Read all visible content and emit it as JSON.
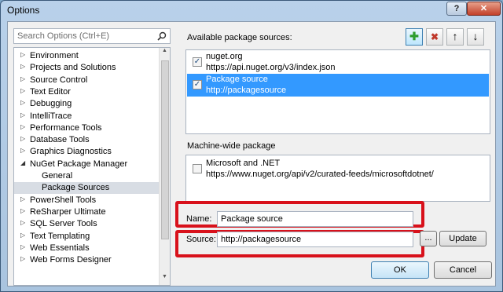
{
  "window": {
    "title": "Options",
    "help_label": "?",
    "close_label": "✕"
  },
  "search": {
    "placeholder": "Search Options (Ctrl+E)"
  },
  "tree": {
    "items": [
      {
        "label": "Environment",
        "expanded": false
      },
      {
        "label": "Projects and Solutions",
        "expanded": false
      },
      {
        "label": "Source Control",
        "expanded": false
      },
      {
        "label": "Text Editor",
        "expanded": false
      },
      {
        "label": "Debugging",
        "expanded": false
      },
      {
        "label": "IntelliTrace",
        "expanded": false
      },
      {
        "label": "Performance Tools",
        "expanded": false
      },
      {
        "label": "Database Tools",
        "expanded": false
      },
      {
        "label": "Graphics Diagnostics",
        "expanded": false
      },
      {
        "label": "NuGet Package Manager",
        "expanded": true
      },
      {
        "label": "General",
        "child": true
      },
      {
        "label": "Package Sources",
        "child": true,
        "selected": true
      },
      {
        "label": "PowerShell Tools",
        "expanded": false
      },
      {
        "label": "ReSharper Ultimate",
        "expanded": false
      },
      {
        "label": "SQL Server Tools",
        "expanded": false
      },
      {
        "label": "Text Templating",
        "expanded": false
      },
      {
        "label": "Web Essentials",
        "expanded": false
      },
      {
        "label": "Web Forms Designer",
        "expanded": false
      }
    ]
  },
  "available": {
    "label": "Available package sources:",
    "sources": [
      {
        "name": "nuget.org",
        "url": "https://api.nuget.org/v3/index.json",
        "checked": true,
        "selected": false
      },
      {
        "name": "Package source",
        "url": "http://packagesource",
        "checked": true,
        "selected": true
      }
    ]
  },
  "toolbar": {
    "add": "✚",
    "remove": "✖",
    "up": "↑",
    "down": "↓"
  },
  "machine_wide": {
    "label": "Machine-wide package",
    "sources": [
      {
        "name": "Microsoft and .NET",
        "url": "https://www.nuget.org/api/v2/curated-feeds/microsoftdotnet/",
        "checked": false
      }
    ]
  },
  "form": {
    "name_label": "Name:",
    "name_value": "Package source",
    "source_label": "Source:",
    "source_value": "http://packagesource",
    "browse_label": "...",
    "update_label": "Update"
  },
  "buttons": {
    "ok": "OK",
    "cancel": "Cancel"
  },
  "colors": {
    "highlight": "#d8111b",
    "selection": "#3399ff",
    "add_icon": "#2e9d2e",
    "remove_icon": "#c0392b"
  }
}
